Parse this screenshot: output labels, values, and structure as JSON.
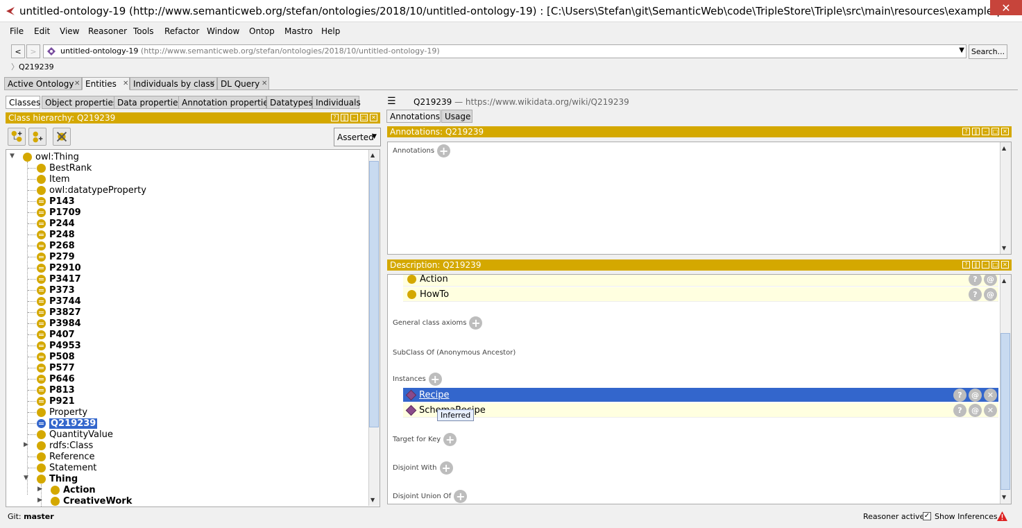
{
  "window": {
    "title": "untitled-ontology-19 (http://www.semanticweb.org/stefan/ontologies/2018/10/untitled-ontology-19)  : [C:\\Users\\Stefan\\git\\SemanticWeb\\code\\TripleStore\\Triple\\src\\main\\resources\\examplequeries\\...",
    "close_glyph": "✕"
  },
  "menu": [
    "File",
    "Edit",
    "View",
    "Reasoner",
    "Tools",
    "Refactor",
    "Window",
    "Ontop",
    "Mastro",
    "Help"
  ],
  "nav": {
    "back": "<",
    "forward": ">",
    "ontology_name": "untitled-ontology-19",
    "ontology_iri": "(http://www.semanticweb.org/stefan/ontologies/2018/10/untitled-ontology-19)",
    "search_label": "Search...",
    "breadcrumb": "Q219239"
  },
  "main_tabs": [
    {
      "label": "Active Ontology"
    },
    {
      "label": "Entities"
    },
    {
      "label": "Individuals by class"
    },
    {
      "label": "DL Query"
    }
  ],
  "left_tabs": [
    "Classes",
    "Object properties",
    "Data properties",
    "Annotation properties",
    "Datatypes",
    "Individuals"
  ],
  "class_hierarchy": {
    "title": "Class hierarchy: Q219239",
    "mode": "Asserted",
    "nodes": [
      "owl:Thing",
      "BestRank",
      "Item",
      "owl:datatypeProperty",
      "P143",
      "P1709",
      "P244",
      "P248",
      "P268",
      "P279",
      "P2910",
      "P3417",
      "P373",
      "P3744",
      "P3827",
      "P3984",
      "P407",
      "P4953",
      "P508",
      "P577",
      "P646",
      "P813",
      "P921",
      "Property",
      "Q219239",
      "QuantityValue",
      "rdfs:Class",
      "Reference",
      "Statement",
      "Thing",
      "Action",
      "CreativeWork"
    ]
  },
  "right": {
    "entity_label": "Q219239",
    "entity_iri": "— https://www.wikidata.org/wiki/Q219239",
    "tabs": [
      "Annotations",
      "Usage"
    ],
    "annotations_title": "Annotations: Q219239",
    "annotations_label": "Annotations",
    "description_title": "Description: Q219239",
    "superclasses": [
      "Action",
      "HowTo"
    ],
    "sections": {
      "general_class_axioms": "General class axioms",
      "subclass_anonymous": "SubClass Of (Anonymous Ancestor)",
      "instances": "Instances",
      "target_for_key": "Target for Key",
      "disjoint_with": "Disjoint With",
      "disjoint_union_of": "Disjoint Union Of"
    },
    "instances": [
      "Recipe",
      "SchemaRecipe"
    ],
    "tooltip": "Inferred"
  },
  "status": {
    "git": "Git:",
    "branch": "master",
    "reasoner": "Reasoner active",
    "show_inferences": "Show Inferences",
    "show_inferences_checked": true
  },
  "colors": {
    "gold": "#d4a800",
    "selection": "#3366cc",
    "row_bg": "#ffffe0",
    "instance_diamond": "#8a4a8a"
  }
}
